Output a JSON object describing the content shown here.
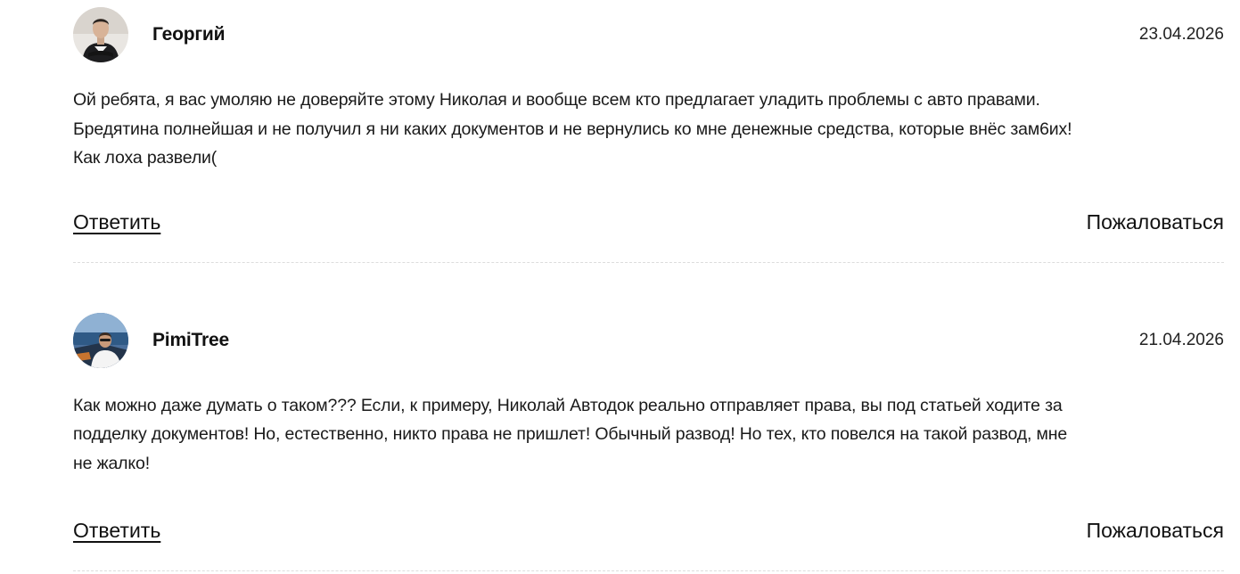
{
  "comments": [
    {
      "author": "Георгий",
      "date": "23.04.2026",
      "text": "Ой ребята, я вас умоляю не доверяйте этому Николая и вообще всем кто предлагает уладить проблемы с авто правами.\nБредятина полнейшая и не получил я ни каких документов и не вернулись ко мне денежные средства, которые внёс зам6их!\nКак лоха развели(",
      "reply_label": "Ответить",
      "report_label": "Пожаловаться"
    },
    {
      "author": "PimiTree",
      "date": "21.04.2026",
      "text": "Как можно даже думать о таком??? Если, к примеру, Николай Автодок реально отправляет права, вы под статьей ходите за\nподделку документов! Но, естественно, никто права не пришлет! Обычный развод! Но тех, кто повелся на такой развод, мне\nне жалко!",
      "reply_label": "Ответить",
      "report_label": "Пожаловаться"
    }
  ]
}
